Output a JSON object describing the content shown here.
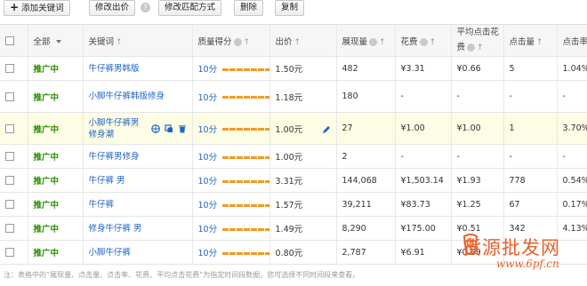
{
  "toolbar": {
    "add_keyword": "添加关键词",
    "modify_bid": "修改出价",
    "help": "?",
    "modify_match": "修改匹配方式",
    "delete": "删除",
    "copy": "复制"
  },
  "table": {
    "headers": {
      "all": "全部",
      "keyword": "关键词",
      "quality": "质量得分",
      "bid": "出价",
      "impressions": "展现量",
      "cost": "花费",
      "avg_cpc_line1": "平均点击花",
      "avg_cpc_line2": "费",
      "clicks": "点击量",
      "ctr": "点击率"
    },
    "rows": [
      {
        "status": "推广中",
        "keyword": "牛仔裤男韩版",
        "quality": "10分",
        "bid": "1.50元",
        "impressions": "482",
        "cost": "¥3.31",
        "avg_cpc": "¥0.66",
        "clicks": "5",
        "ctr": "1.04%"
      },
      {
        "status": "推广中",
        "keyword": "小脚牛仔裤韩版修身",
        "quality": "10分",
        "bid": "1.18元",
        "impressions": "180",
        "cost": "-",
        "avg_cpc": "-",
        "clicks": "-",
        "ctr": "-"
      },
      {
        "status": "推广中",
        "keyword": "小脚牛仔裤男修身潮",
        "quality": "10分",
        "bid": "1.00元",
        "impressions": "27",
        "cost": "¥1.00",
        "avg_cpc": "¥1.00",
        "clicks": "1",
        "ctr": "3.70%"
      },
      {
        "status": "推广中",
        "keyword": "牛仔裤男修身",
        "quality": "10分",
        "bid": "1.00元",
        "impressions": "2",
        "cost": "-",
        "avg_cpc": "-",
        "clicks": "-",
        "ctr": "-"
      },
      {
        "status": "推广中",
        "keyword": "牛仔裤 男",
        "quality": "10分",
        "bid": "3.31元",
        "impressions": "144,068",
        "cost": "¥1,503.14",
        "avg_cpc": "¥1.93",
        "clicks": "778",
        "ctr": "0.54%"
      },
      {
        "status": "推广中",
        "keyword": "牛仔裤",
        "quality": "10分",
        "bid": "1.57元",
        "impressions": "39,211",
        "cost": "¥83.73",
        "avg_cpc": "¥1.25",
        "clicks": "67",
        "ctr": "0.17%"
      },
      {
        "status": "推广中",
        "keyword": "修身牛仔裤 男",
        "quality": "10分",
        "bid": "1.49元",
        "impressions": "8,290",
        "cost": "¥175.00",
        "avg_cpc": "¥0.51",
        "clicks": "342",
        "ctr": "4.13%"
      },
      {
        "status": "推广中",
        "keyword": "小脚牛仔裤",
        "quality": "10分",
        "bid": "0.80元",
        "impressions": "2,787",
        "cost": "¥6.91",
        "avg_cpc": "¥0.69",
        "clicks": "",
        "ctr": ""
      }
    ]
  },
  "quality_level": "10/10",
  "note": "注：表格中的“展现量、点击量、点击率、花费、平均点击花费”为指定时间段数据，您可选择不同时间段来查看。",
  "watermark": {
    "text": "货源批发网",
    "url": "www.6pf.cn"
  },
  "colors": {
    "status": "#2a8e00",
    "link": "#1f64c8",
    "bar": "#f39a1e",
    "highlight_row": "#fdfce4",
    "watermark": "#e8612b"
  }
}
